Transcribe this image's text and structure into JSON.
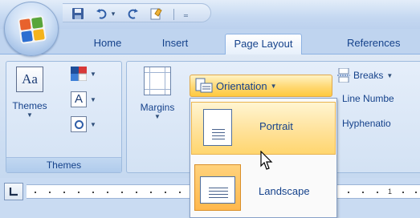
{
  "quick_access": {
    "items": [
      "save-icon",
      "undo-icon",
      "undo-dropdown-icon",
      "redo-icon",
      "spell-icon",
      "customize-icon"
    ]
  },
  "tabs": [
    {
      "label": "Home"
    },
    {
      "label": "Insert"
    },
    {
      "label": "Page Layout"
    },
    {
      "label": "References"
    }
  ],
  "themes_group": {
    "label": "Themes",
    "themes_button": "Themes"
  },
  "page_setup": {
    "margins_button": "Margins",
    "orientation_button": "Orientation",
    "breaks_button": "Breaks",
    "line_numbers_button": "Line Numbe",
    "hyphenation_button": "Hyphenatio"
  },
  "orientation_menu": {
    "items": [
      {
        "label": "Portrait",
        "selected": true
      },
      {
        "label": "Landscape",
        "selected": false
      }
    ]
  },
  "ruler": {
    "numbers": [
      "1"
    ]
  },
  "colors": {
    "accent_text": "#15428b",
    "highlight": "#ffd66f"
  }
}
